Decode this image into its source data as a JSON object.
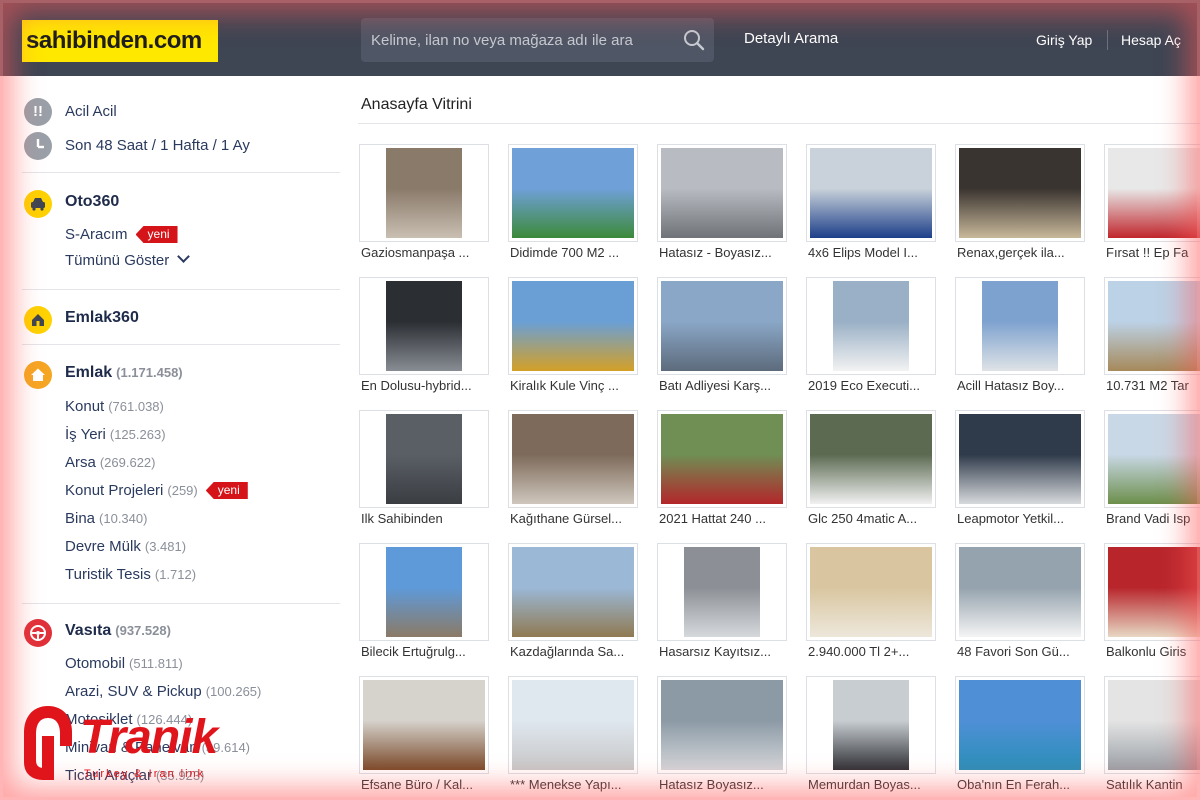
{
  "header": {
    "logo": "sahibinden.com",
    "search_placeholder": "Kelime, ilan no veya mağaza adı ile ara",
    "detailed_search": "Detaylı Arama",
    "login": "Giriş Yap",
    "register": "Hesap Aç",
    "bg_color": "#3e4553",
    "logo_color": "#ffe800"
  },
  "sidebar": {
    "urgent": "Acil Acil",
    "recent": "Son 48 Saat / 1 Hafta / 1 Ay",
    "oto360": "Oto360",
    "s_aracim": "S-Aracım",
    "new_badge": "yeni",
    "show_all": "Tümünü Göster",
    "emlak360": "Emlak360",
    "emlak": {
      "label": "Emlak",
      "count": "(1.171.458)"
    },
    "emlak_items": [
      {
        "label": "Konut",
        "count": "(761.038)"
      },
      {
        "label": "İş Yeri",
        "count": "(125.263)"
      },
      {
        "label": "Arsa",
        "count": "(269.622)"
      },
      {
        "label": "Konut Projeleri",
        "count": "(259)"
      },
      {
        "label": "Bina",
        "count": "(10.340)"
      },
      {
        "label": "Devre Mülk",
        "count": "(3.481)"
      },
      {
        "label": "Turistik Tesis",
        "count": "(1.712)"
      }
    ],
    "vasita": {
      "label": "Vasıta",
      "count": "(937.528)"
    },
    "vasita_items": [
      {
        "label": "Otomobil",
        "count": "(511.811)"
      },
      {
        "label": "Arazi, SUV & Pickup",
        "count": "(100.265)"
      },
      {
        "label": "Motosiklet",
        "count": "(126.444)"
      },
      {
        "label": "Minivan & Panelvan",
        "count": "(39.614)"
      },
      {
        "label": "Ticari Araçlar",
        "count": "(35.923)"
      }
    ]
  },
  "main": {
    "title": "Anasayfa Vitrini",
    "listings": [
      "Gaziosmanpaşa ...",
      "Didimde 700 M2 ...",
      "Hatasız - Boyasız...",
      "4x6 Elips Model I...",
      "Renax,gerçek ila...",
      "Fırsat !! Ep Fa",
      "En Dolusu-hybrid...",
      "Kiralık Kule Vinç ...",
      "Batı Adliyesi Karş...",
      "2019 Eco Executi...",
      "Acill Hatasız Boy...",
      "10.731 M2 Tar",
      "Ilk Sahibinden",
      "Kağıthane Gürsel...",
      "2021 Hattat 240 ...",
      "Glc 250 4matic A...",
      "Leapmotor Yetkil...",
      "Brand Vadi Isp",
      "Bilecik Ertuğrulg...",
      "Kazdağlarında Sa...",
      "Hasarsız Kayıtsız...",
      "2.940.000 Tl 2+...",
      "48 Favori Son Gü...",
      "Balkonlu Giris",
      "Efsane Büro / Kal...",
      "*** Menekse Yapı...",
      "Hatasız Boyasız...",
      "Memurdan Boyas...",
      "Oba'nın En Ferah...",
      "Satılık Kantin"
    ]
  },
  "watermark": {
    "brand": "Tranik",
    "tagline": "Turkey & Iran link"
  }
}
